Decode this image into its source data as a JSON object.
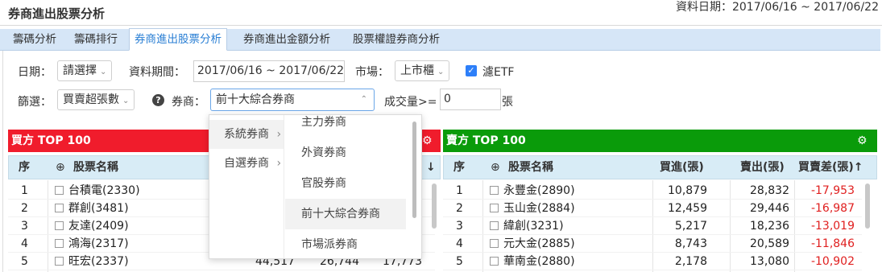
{
  "page": {
    "title": "券商進出股票分析",
    "date_range": "資料日期：2017/06/16 ~ 2017/06/22"
  },
  "tabs": [
    {
      "label": "籌碼分析"
    },
    {
      "label": "籌碼排行"
    },
    {
      "label": "券商進出股票分析",
      "active": true
    },
    {
      "label": "券商進出金額分析"
    },
    {
      "label": "股票權證券商分析"
    }
  ],
  "filters": {
    "date_label": "日期：",
    "date_select": "請選擇",
    "period_label": "資料期間：",
    "period_value": "2017/06/16 ~ 2017/06/22",
    "market_label": "市場：",
    "market_select": "上市櫃",
    "etf_label": "濾ETF",
    "filter_label": "篩選：",
    "filter_select": "買賣超張數",
    "broker_label": "券商：",
    "broker_select": "前十大綜合券商",
    "volume_label": "成交量>=",
    "volume_value": "0",
    "volume_unit": "張"
  },
  "dropdown": {
    "left_items": [
      {
        "label": "系統券商",
        "arrow": "›"
      },
      {
        "label": "自選券商",
        "arrow": "›"
      }
    ],
    "right_items": [
      {
        "label": "主力券商"
      },
      {
        "label": "外資券商"
      },
      {
        "label": "官股券商"
      },
      {
        "label": "前十大綜合券商"
      },
      {
        "label": "市場派券商"
      }
    ]
  },
  "buy_table": {
    "title": "買方 TOP 100",
    "columns": {
      "seq": "序",
      "name": "股票名稱",
      "sort_arrow": "↓"
    },
    "rows": [
      {
        "seq": "1",
        "name": "台積電(2330)"
      },
      {
        "seq": "2",
        "name": "群創(3481)"
      },
      {
        "seq": "3",
        "name": "友達(2409)"
      },
      {
        "seq": "4",
        "name": "鴻海(2317)"
      },
      {
        "seq": "5",
        "name": "旺宏(2337)",
        "buy": "44,517",
        "sell": "26,744",
        "diff": "17,773"
      }
    ]
  },
  "sell_table": {
    "title": "賣方 TOP 100",
    "columns": {
      "seq": "序",
      "name": "股票名稱",
      "buy": "買進(張)",
      "sell": "賣出(張)",
      "diff": "買賣差(張)↑"
    },
    "rows": [
      {
        "seq": "1",
        "name": "永豐金(2890)",
        "buy": "10,879",
        "sell": "28,832",
        "diff": "-17,953"
      },
      {
        "seq": "2",
        "name": "玉山金(2884)",
        "buy": "12,459",
        "sell": "29,446",
        "diff": "-16,987"
      },
      {
        "seq": "3",
        "name": "緯創(3231)",
        "buy": "5,217",
        "sell": "18,236",
        "diff": "-13,019"
      },
      {
        "seq": "4",
        "name": "元大金(2885)",
        "buy": "8,743",
        "sell": "20,589",
        "diff": "-11,846"
      },
      {
        "seq": "5",
        "name": "華南金(2880)",
        "buy": "2,178",
        "sell": "13,080",
        "diff": "-10,902"
      }
    ]
  },
  "icons": {
    "plus": "⊕",
    "gear": "⚙",
    "help": "?",
    "check": "✓",
    "caret": "⌄"
  },
  "colors": {
    "buy_header": "#f01c2c",
    "sell_header": "#0a9b0a",
    "active_tab": "#2a7fd4",
    "negative": "#e02020"
  }
}
